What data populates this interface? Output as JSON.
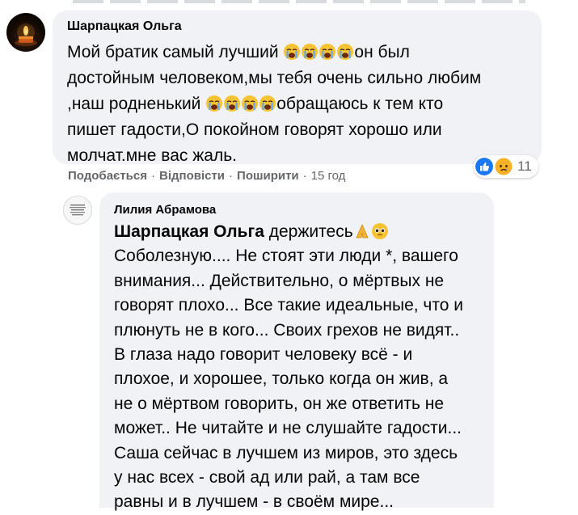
{
  "comment1": {
    "author": "Шарпацкая Ольга",
    "lines": [
      [
        "Мой братик самый лучший ",
        "crying",
        "он был"
      ],
      [
        "достойным человеком,мы тебя очень сильно любим"
      ],
      [
        ",наш родненький ",
        "crying",
        "обращаюсь к тем кто"
      ],
      [
        "пишет гадости,О покойном говорят хорошо или"
      ],
      [
        "молчат.мне вас жаль."
      ]
    ],
    "reactions": {
      "icons": [
        "like-icon",
        "sad-icon"
      ],
      "count": "11"
    },
    "actions": {
      "like": "Подобається",
      "reply": "Відповісти",
      "share": "Поширити",
      "time": "15 год"
    }
  },
  "comment2": {
    "author": "Лилия Абрамова",
    "mention": "Шарпацкая Ольга",
    "first_line_rest": " держитесь",
    "lines": [
      "Соболезную.... Не стоят эти люди *, вашего",
      "внимания... Действительно, о мёртвых не",
      "говорят плохо... Все такие идеальные, что и",
      "плюнуть не в кого... Своих грехов не видят..",
      "В глаза надо говорит человеку всё - и",
      "плохое, и хорошее, только когда он жив, а",
      "не о мёртвом говорить, он же ответить не",
      "может.. Не читайте и не слушайте гадости...",
      "Саша сейчас в лучшем из миров, это здесь",
      "у нас всех - свой ад или рай, а там все",
      "равны и в лучшем - в своём мире..."
    ]
  },
  "colors": {
    "bubble": "#f0f2f5",
    "meta": "#65676b",
    "like": "#1877f2",
    "sad": "#f7b125"
  }
}
